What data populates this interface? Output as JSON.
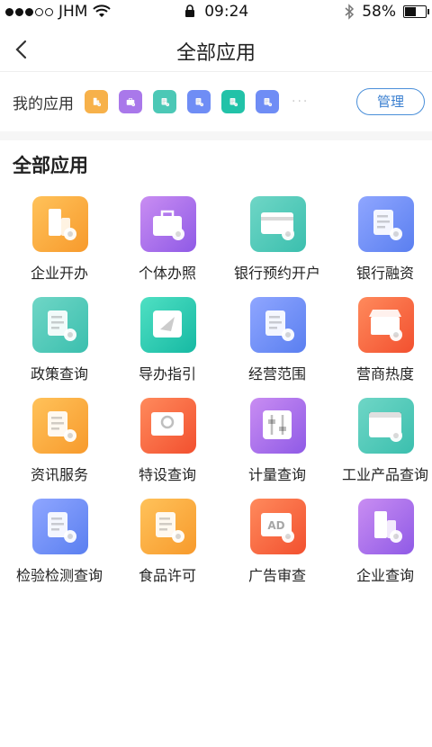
{
  "status_bar": {
    "carrier": "JHM",
    "time": "09:24",
    "battery": "58%",
    "battery_level": 0.58,
    "signal_bars": 3
  },
  "nav": {
    "title": "全部应用"
  },
  "my_apps": {
    "label": "我的应用",
    "icons": [
      {
        "name": "building-icon",
        "color": "#f7b14a"
      },
      {
        "name": "briefcase-icon",
        "color": "#a978ea"
      },
      {
        "name": "card-icon",
        "color": "#4cc8b6"
      },
      {
        "name": "document-icon",
        "color": "#6f8df5"
      },
      {
        "name": "screen-icon",
        "color": "#22c2a8"
      },
      {
        "name": "form-icon",
        "color": "#6f8df5"
      }
    ],
    "more": "···",
    "manage_label": "管理"
  },
  "section": {
    "title": "全部应用"
  },
  "apps": [
    {
      "label": "企业开办",
      "icon": "building-icon",
      "color": "orange"
    },
    {
      "label": "个体办照",
      "icon": "briefcase-icon",
      "color": "purple"
    },
    {
      "label": "银行预约开户",
      "icon": "bank-card-icon",
      "color": "teal"
    },
    {
      "label": "银行融资",
      "icon": "finance-icon",
      "color": "blue"
    },
    {
      "label": "政策查询",
      "icon": "certificate-icon",
      "color": "teal"
    },
    {
      "label": "导办指引",
      "icon": "paper-plane-icon",
      "color": "cyan"
    },
    {
      "label": "经营范围",
      "icon": "search-document-icon",
      "color": "blue"
    },
    {
      "label": "营商热度",
      "icon": "store-icon",
      "color": "red"
    },
    {
      "label": "资讯服务",
      "icon": "news-icon",
      "color": "orange"
    },
    {
      "label": "特设查询",
      "icon": "equipment-search-icon",
      "color": "red"
    },
    {
      "label": "计量查询",
      "icon": "sliders-icon",
      "color": "purple"
    },
    {
      "label": "工业产品查询",
      "icon": "box-icon",
      "color": "teal"
    },
    {
      "label": "检验检测查询",
      "icon": "inspection-icon",
      "color": "blue"
    },
    {
      "label": "食品许可",
      "icon": "food-license-icon",
      "color": "orange"
    },
    {
      "label": "广告审查",
      "icon": "ad-icon",
      "color": "red"
    },
    {
      "label": "企业查询",
      "icon": "company-search-icon",
      "color": "purple"
    }
  ]
}
